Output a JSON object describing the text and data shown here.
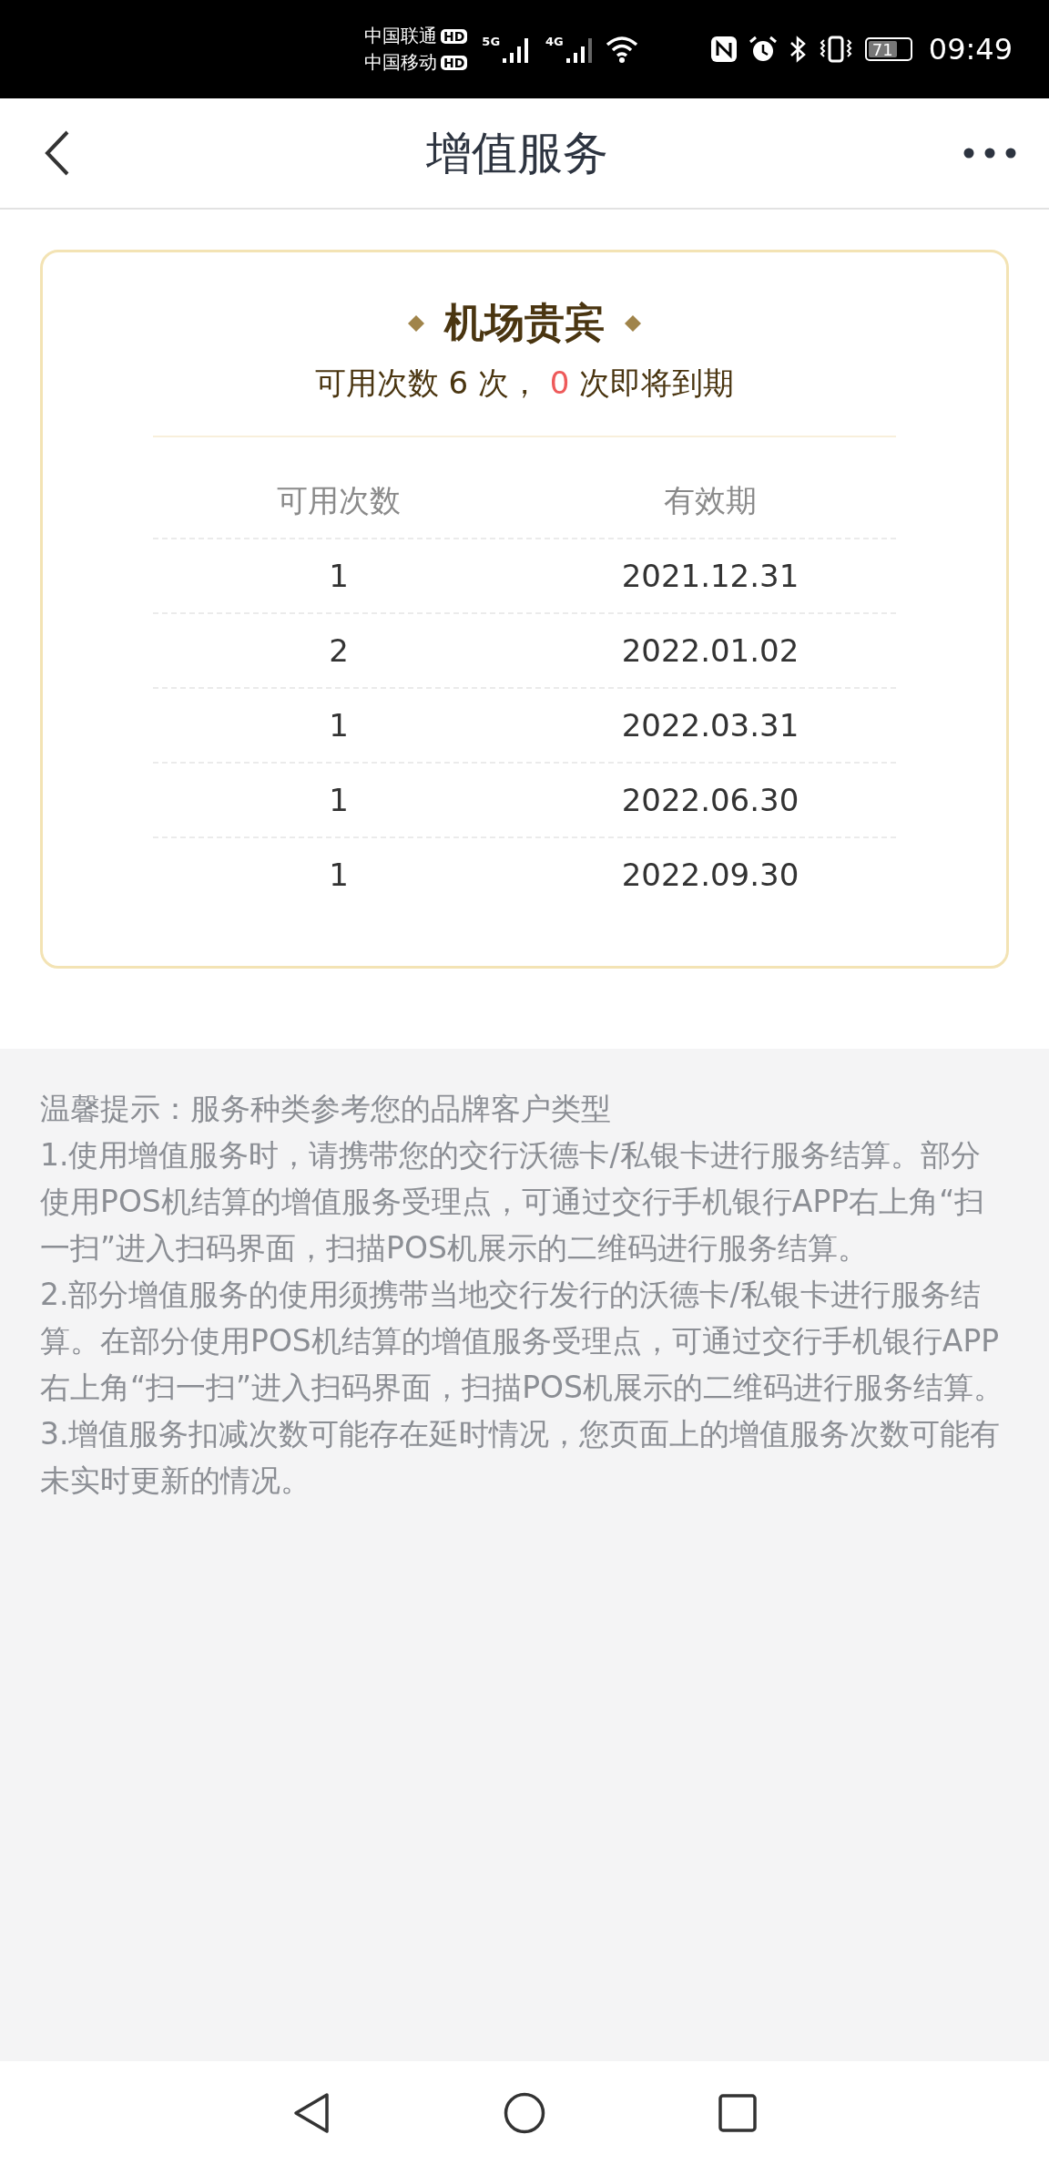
{
  "status_bar": {
    "carriers": [
      {
        "name": "中国联通",
        "badge": "HD"
      },
      {
        "name": "中国移动",
        "badge": "HD"
      }
    ],
    "networks": [
      "5G",
      "4G"
    ],
    "battery": "71",
    "time": "09:49"
  },
  "header": {
    "title": "增值服务"
  },
  "card": {
    "title": "机场贵宾",
    "summary": {
      "before": "可用次数 6 次，",
      "expiring": "0",
      "after": "次即将到期"
    },
    "columns": [
      "可用次数",
      "有效期"
    ],
    "rows": [
      [
        "1",
        "2021.12.31"
      ],
      [
        "2",
        "2022.01.02"
      ],
      [
        "1",
        "2022.03.31"
      ],
      [
        "1",
        "2022.06.30"
      ],
      [
        "1",
        "2022.09.30"
      ]
    ]
  },
  "notes": [
    "温馨提示：服务种类参考您的品牌客户类型",
    "1.使用增值服务时，请携带您的交行沃德卡/私银卡进行服务结算。部分使用POS机结算的增值服务受理点，可通过交行手机银行APP右上角“扫一扫”进入扫码界面，扫描POS机展示的二维码进行服务结算。",
    "2.部分增值服务的使用须携带当地交行发行的沃德卡/私银卡进行服务结算。在部分使用POS机结算的增值服务受理点，可通过交行手机银行APP右上角“扫一扫”进入扫码界面，扫描POS机展示的二维码进行服务结算。",
    "3.增值服务扣减次数可能存在延时情况，您页面上的增值服务次数可能有未实时更新的情况。"
  ]
}
